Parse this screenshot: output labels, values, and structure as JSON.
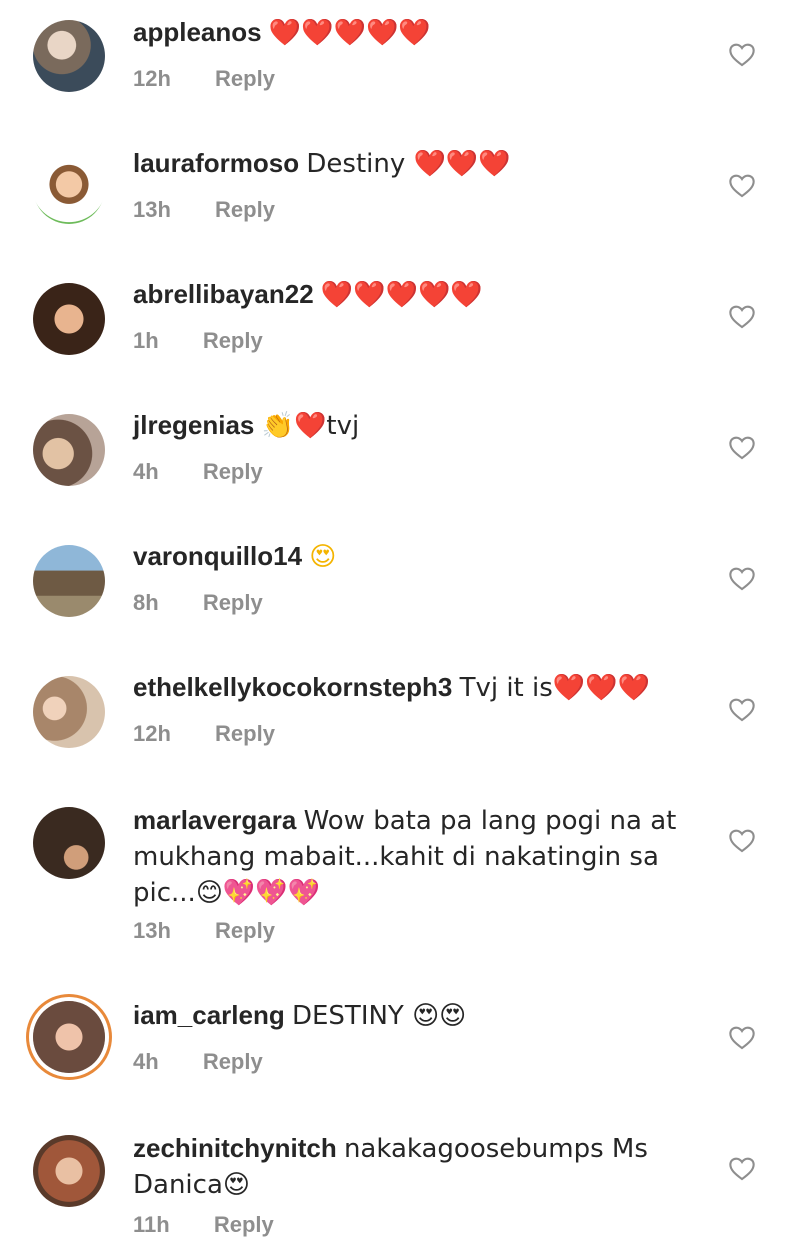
{
  "icons": {
    "like": "heart-outline-icon"
  },
  "colors": {
    "username": "#262626",
    "meta": "#8e8e8e",
    "like_outline": "#8e8e8e",
    "story_ring": "#e8893a"
  },
  "comments": [
    {
      "username": "appleanos",
      "text": "❤️❤️❤️❤️❤️",
      "time": "12h",
      "reply": "Reply"
    },
    {
      "username": "lauraformoso",
      "text": "Destiny ❤️❤️❤️",
      "time": "13h",
      "reply": "Reply"
    },
    {
      "username": "abrellibayan22",
      "text": "❤️❤️❤️❤️❤️",
      "time": "1h",
      "reply": "Reply"
    },
    {
      "username": "jlregenias",
      "text": "👏❤️tvj",
      "time": "4h",
      "reply": "Reply"
    },
    {
      "username": "varonquillo14",
      "text": "😍",
      "time": "8h",
      "reply": "Reply"
    },
    {
      "username": "ethelkellykocokornsteph3",
      "text": "Tvj it is❤️❤️❤️",
      "time": "12h",
      "reply": "Reply"
    },
    {
      "username": "marlavergara",
      "text": "Wow bata pa lang pogi na at mukhang mabait...kahit di nakatingin sa pic...😊💖💖💖",
      "time": "13h",
      "reply": "Reply"
    },
    {
      "username": "iam_carleng",
      "text": "DESTINY 😍😍",
      "time": "4h",
      "reply": "Reply"
    },
    {
      "username": "zechinitchynitch",
      "text": "nakakagoosebumps Ms Danica😍",
      "time": "11h",
      "reply": "Reply"
    }
  ]
}
